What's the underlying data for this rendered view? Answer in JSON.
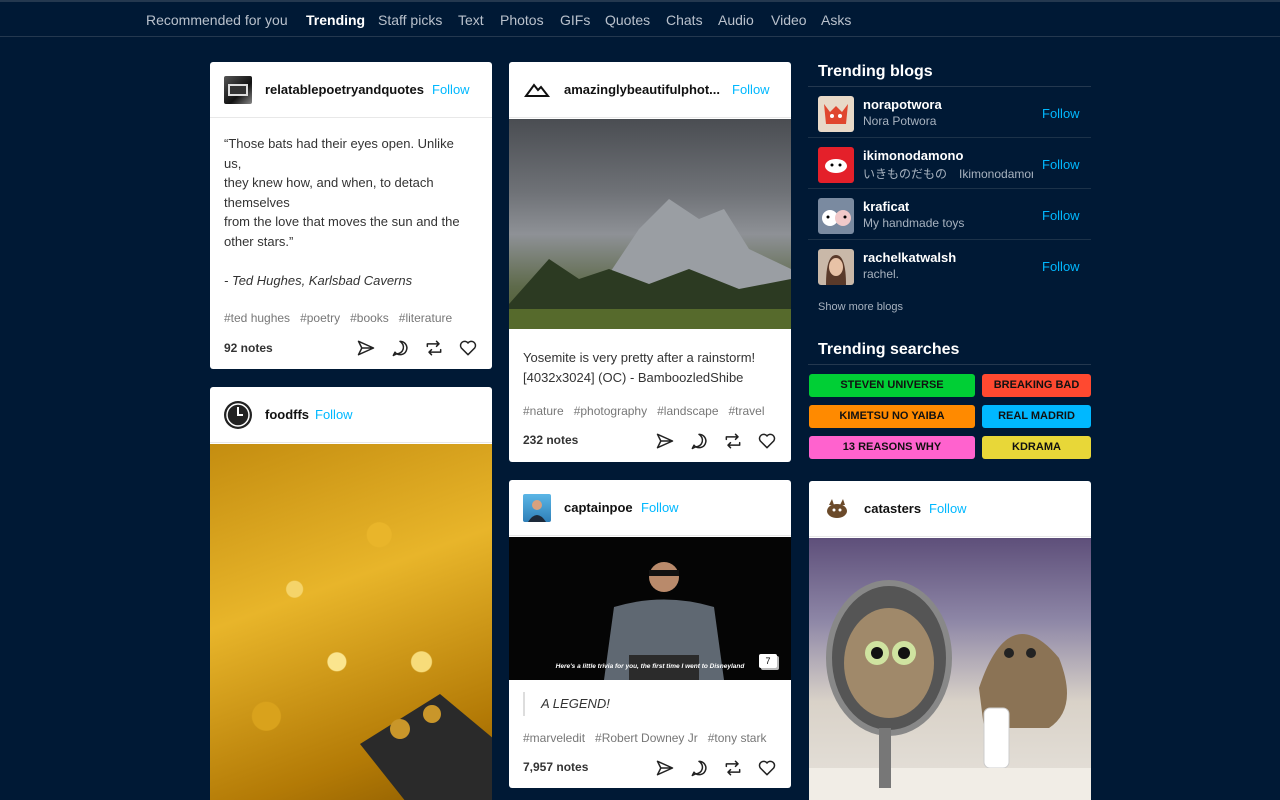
{
  "nav": {
    "tabs": [
      "Recommended for you",
      "Trending",
      "Staff picks",
      "Text",
      "Photos",
      "GIFs",
      "Quotes",
      "Chats",
      "Audio",
      "Video",
      "Asks"
    ],
    "active": "Trending"
  },
  "follow_label": "Follow",
  "posts": {
    "poetry": {
      "blog": "relatablepoetryandquotes",
      "lines": [
        "“Those bats had their eyes open. Unlike",
        "us,",
        "they knew how, and when, to detach",
        "themselves",
        "from the love that moves the sun and the",
        "other stars.”"
      ],
      "attribution": "- Ted Hughes, Karlsbad Caverns",
      "tags": [
        "#ted hughes",
        "#poetry",
        "#books",
        "#literature"
      ],
      "notes": "92 notes"
    },
    "yosemite": {
      "blog": "amazinglybeautifulphot...",
      "caption_lines": [
        "Yosemite is very pretty after a rainstorm!",
        "[4032x3024] (OC) - BamboozledShibe"
      ],
      "tags": [
        "#nature",
        "#photography",
        "#landscape",
        "#travel"
      ],
      "notes": "232 notes"
    },
    "foodffs": {
      "blog": "foodffs"
    },
    "captainpoe": {
      "blog": "captainpoe",
      "gif_caption": "Here's a little trivia for you, the first time I went to Disneyland",
      "gif_count": "7",
      "quote": "A LEGEND!",
      "tags": [
        "#marveledit",
        "#Robert Downey Jr",
        "#tony stark"
      ],
      "notes": "7,957 notes"
    },
    "catasters": {
      "blog": "catasters"
    }
  },
  "sidebar": {
    "trending_blogs_title": "Trending blogs",
    "blogs": [
      {
        "name": "norapotwora",
        "sub": "Nora Potwora"
      },
      {
        "name": "ikimonodamono",
        "sub": "いきものだもの　Ikimonodamono"
      },
      {
        "name": "kraficat",
        "sub": "My handmade toys"
      },
      {
        "name": "rachelkatwalsh",
        "sub": "rachel."
      }
    ],
    "show_more": "Show more blogs",
    "trending_searches_title": "Trending searches",
    "searches": [
      {
        "label": "STEVEN UNIVERSE",
        "color": "#00cf35"
      },
      {
        "label": "BREAKING BAD",
        "color": "#ff4930"
      },
      {
        "label": "KIMETSU NO YAIBA",
        "color": "#ff8a00"
      },
      {
        "label": "REAL MADRID",
        "color": "#00b8ff"
      },
      {
        "label": "13 REASONS WHY",
        "color": "#ff62ce"
      },
      {
        "label": "KDRAMA",
        "color": "#e8d738"
      }
    ]
  },
  "colors": {
    "background": "#001935",
    "accent": "#00b8ff"
  }
}
